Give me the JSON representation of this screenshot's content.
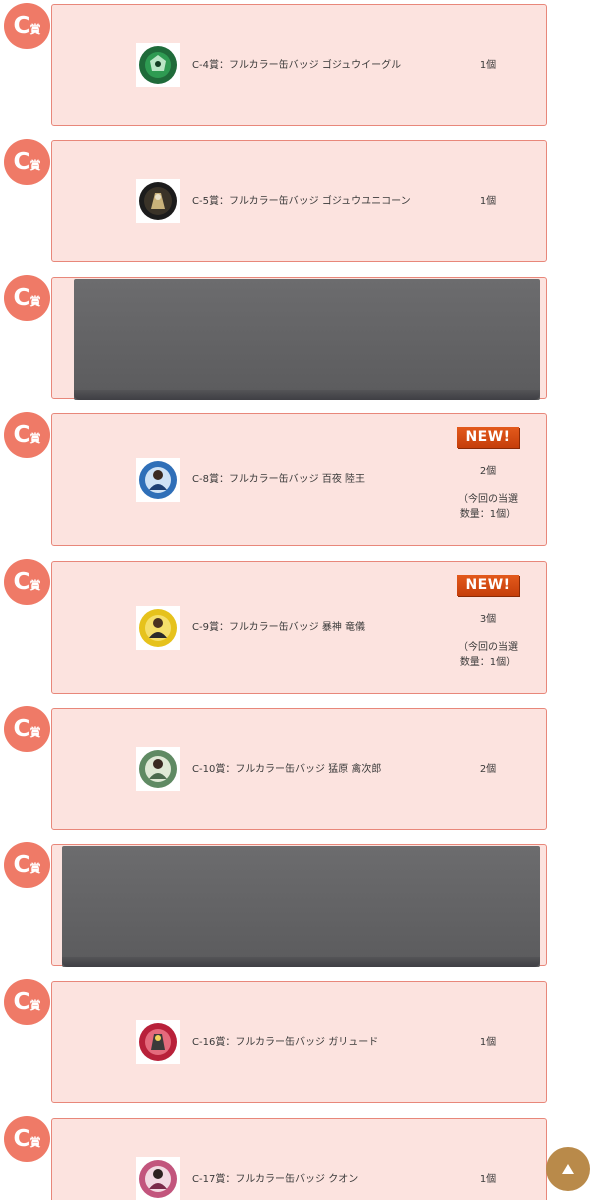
{
  "badge": {
    "letter": "C",
    "kanji": "賞"
  },
  "new_label": "NEW!",
  "scroll_top_icon": "triangle-up-icon",
  "colors": {
    "card_bg": "#fce3df",
    "card_border": "#e8877a",
    "badge_bg": "#ef7a67",
    "new_badge": "#d94a12",
    "scroll_button": "#b98a4a",
    "placeholder": "#626264"
  },
  "prizes": [
    {
      "name": "C-4賞：フルカラー缶バッジ ゴジュウイーグル",
      "qty": "1個",
      "icon": "badge-thumbnail-green"
    },
    {
      "name": "C-5賞：フルカラー缶バッジ ゴジュウユニコーン",
      "qty": "1個",
      "icon": "badge-thumbnail-dark"
    },
    {
      "name": "C-8賞：フルカラー缶バッジ 百夜 陸王",
      "qty": "2個",
      "note": "（今回の当選数量：1個）",
      "is_new": true,
      "icon": "badge-thumbnail-blue"
    },
    {
      "name": "C-9賞：フルカラー缶バッジ 暴神 竜儀",
      "qty": "3個",
      "note": "（今回の当選数量：1個）",
      "is_new": true,
      "icon": "badge-thumbnail-yellow"
    },
    {
      "name": "C-10賞：フルカラー缶バッジ 猛原 禽次郎",
      "qty": "2個",
      "icon": "badge-thumbnail-green-portrait"
    },
    {
      "name": "C-16賞：フルカラー缶バッジ ガリュード",
      "qty": "1個",
      "icon": "badge-thumbnail-red"
    },
    {
      "name": "C-17賞：フルカラー缶バッジ クオン",
      "qty": "1個",
      "icon": "badge-thumbnail-pink"
    }
  ]
}
